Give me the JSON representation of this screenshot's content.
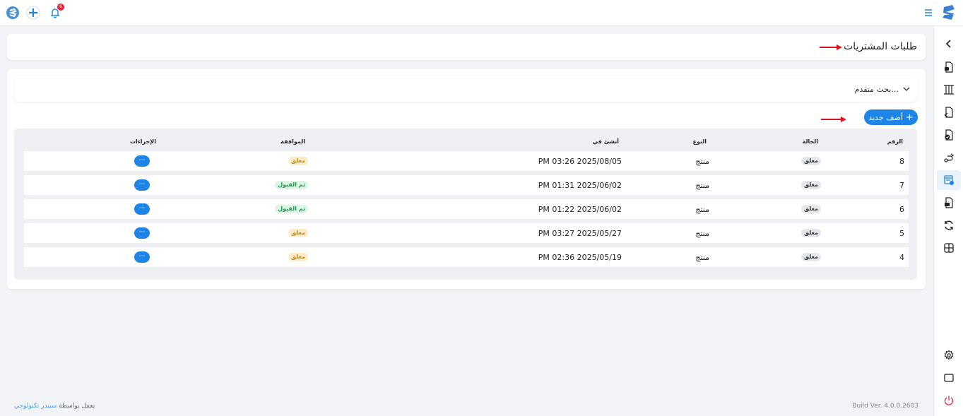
{
  "topbar": {
    "notification_count": "6"
  },
  "page": {
    "title": "طلبات المشتريات"
  },
  "search": {
    "label": "بحث متقدم..."
  },
  "actions": {
    "add_label": "أضف جديد",
    "add_icon": "+"
  },
  "table": {
    "headers": {
      "number": "الرقم",
      "status": "الحالة",
      "type": "النوع",
      "created": "أنشئ في",
      "approval": "الموافقة",
      "actions": "الإجراءات"
    },
    "rows": [
      {
        "number": "8",
        "status": "معلق",
        "type": "منتج",
        "created": "PM 03:26 2025/08/05",
        "approval": "معلق",
        "approval_state": "pending",
        "actions": "···"
      },
      {
        "number": "7",
        "status": "معلق",
        "type": "منتج",
        "created": "PM 01:31 2025/06/02",
        "approval": "تم القبول",
        "approval_state": "approved",
        "actions": "···"
      },
      {
        "number": "6",
        "status": "معلق",
        "type": "منتج",
        "created": "PM 01:22 2025/06/02",
        "approval": "تم القبول",
        "approval_state": "approved",
        "actions": "···"
      },
      {
        "number": "5",
        "status": "معلق",
        "type": "منتج",
        "created": "PM 03:27 2025/05/27",
        "approval": "معلق",
        "approval_state": "pending",
        "actions": "···"
      },
      {
        "number": "4",
        "status": "معلق",
        "type": "منتج",
        "created": "PM 02:36 2025/05/19",
        "approval": "معلق",
        "approval_state": "pending",
        "actions": "···"
      }
    ]
  },
  "footer": {
    "powered_prefix": "يعمل بواسطة",
    "brand": "سبيدر تكنولوجي",
    "build": "Build Ver. 4.0.0.2603"
  },
  "colors": {
    "accent": "#1d85e8",
    "pending": "#c58a12",
    "approved": "#1e9a4d",
    "alert": "#e5243b"
  },
  "icons": {
    "sidebar": [
      "chevron-left-icon",
      "file-lock-icon",
      "columns-icon",
      "file-share-icon",
      "file-check-icon",
      "route-icon",
      "purchase-list-icon",
      "invoice-icon",
      "refresh-icon",
      "grid-icon",
      "gear-icon",
      "monitor-icon",
      "power-icon"
    ]
  }
}
